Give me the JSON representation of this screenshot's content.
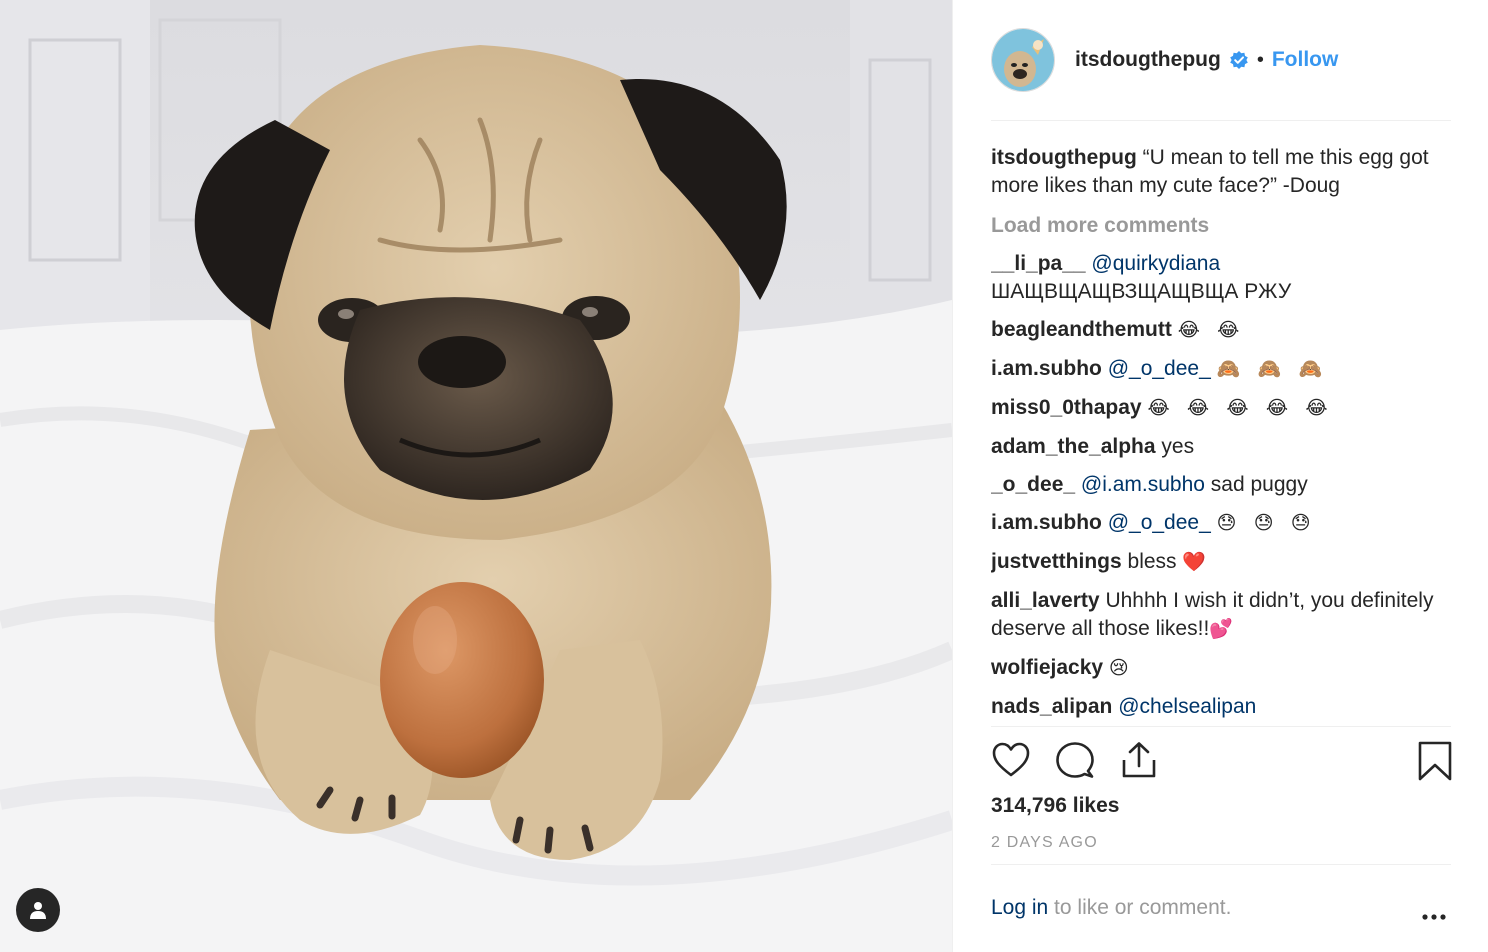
{
  "post": {
    "username": "itsdougthepug",
    "follow_label": "Follow",
    "dot": "•",
    "caption_user": "itsdougthepug",
    "caption_text": "“U mean to tell me this egg got more likes than my cute face?” -Doug",
    "load_more": "Load more comments",
    "likes": "314,796 likes",
    "timestamp": "2 DAYS AGO",
    "login_link": "Log in",
    "login_rest": " to like or comment.",
    "accent_color": "#3897f0"
  },
  "comments": [
    {
      "author": "__li_pa__",
      "mention": "@quirkydiana",
      "text": "ШАЩВЩАЩВЗЩАЩВЩА РЖУ"
    },
    {
      "author": "beagleandthemutt",
      "emoji": "😂 😂"
    },
    {
      "author": "i.am.subho",
      "mention": "@_o_dee_",
      "emoji": "🙈 🙈 🙈"
    },
    {
      "author": "miss0_0thapay",
      "emoji": "😂 😂 😂 😂 😂"
    },
    {
      "author": "adam_the_alpha",
      "text": "yes"
    },
    {
      "author": "_o_dee_",
      "mention": "@i.am.subho",
      "text": "sad puggy"
    },
    {
      "author": "i.am.subho",
      "mention": "@_o_dee_",
      "emoji": "😓 😓 😓"
    },
    {
      "author": "justvetthings",
      "text": "bless",
      "emoji": "❤️"
    },
    {
      "author": "alli_laverty",
      "text": "Uhhhh I wish it didn’t, you definitely deserve all those likes!!",
      "emoji": "💕"
    },
    {
      "author": "wolfiejacky",
      "emoji": "😢"
    },
    {
      "author": "nads_alipan",
      "mention": "@chelsealipan"
    }
  ],
  "icons": {
    "like": "heart-icon",
    "comment": "speech-bubble-icon",
    "share": "share-icon",
    "save": "bookmark-icon",
    "verified": "verified-badge-icon",
    "more": "ellipsis-icon",
    "user_tag": "person-icon"
  }
}
